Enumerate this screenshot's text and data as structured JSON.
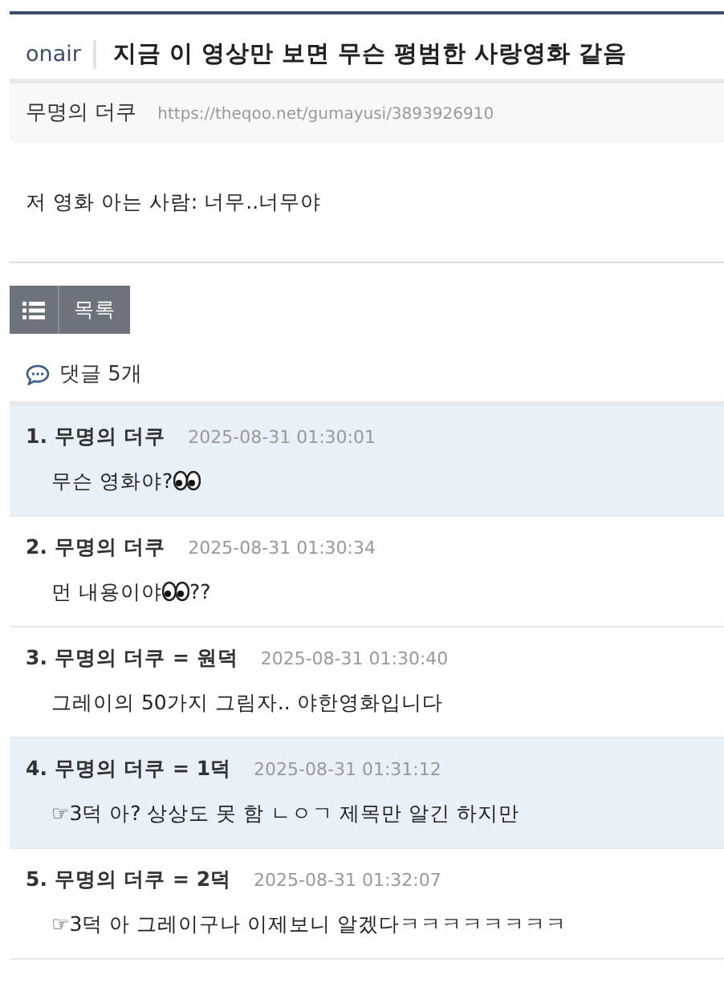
{
  "post": {
    "category": "onair",
    "title": "지금 이 영상만 보면 무슨 평범한 사랑영화 같음",
    "author": "무명의 더쿠",
    "url": "https://theqoo.net/gumayusi/3893926910",
    "body": "저 영화 아는 사람: 너무..너무야"
  },
  "buttons": [
    {
      "kind": "list-icon"
    },
    {
      "kind": "label",
      "label": "목록"
    }
  ],
  "comments_header": "댓글 5개",
  "comments": [
    {
      "number": "1.",
      "author": "무명의 더쿠",
      "time": "2025-08-31 01:30:01",
      "highlighted": true,
      "body": [
        {
          "kind": "text",
          "text": "무슨 영화야?"
        },
        {
          "kind": "eyes"
        }
      ]
    },
    {
      "number": "2.",
      "author": "무명의 더쿠",
      "time": "2025-08-31 01:30:34",
      "highlighted": false,
      "body": [
        {
          "kind": "text",
          "text": "먼 내용이야"
        },
        {
          "kind": "eyes"
        },
        {
          "kind": "text",
          "text": "??"
        }
      ]
    },
    {
      "number": "3.",
      "author": "무명의 더쿠",
      "badge": "= 원덕",
      "time": "2025-08-31 01:30:40",
      "highlighted": false,
      "body": [
        {
          "kind": "text",
          "text": "그레이의 50가지 그림자.. 야한영화입니다"
        }
      ]
    },
    {
      "number": "4.",
      "author": "무명의 더쿠",
      "badge": "= 1덕",
      "time": "2025-08-31 01:31:12",
      "highlighted": true,
      "body": [
        {
          "kind": "text",
          "text": "☞3덕 아? 상상도 못 함 ㄴㅇㄱ 제목만 알긴 하지만"
        }
      ]
    },
    {
      "number": "5.",
      "author": "무명의 더쿠",
      "badge": "= 2덕",
      "time": "2025-08-31 01:32:07",
      "highlighted": false,
      "body": [
        {
          "kind": "text",
          "text": "☞3덕 아 그레이구나 이제보니 알겠다ㅋㅋㅋㅋㅋㅋㅋㅋ"
        }
      ]
    }
  ]
}
